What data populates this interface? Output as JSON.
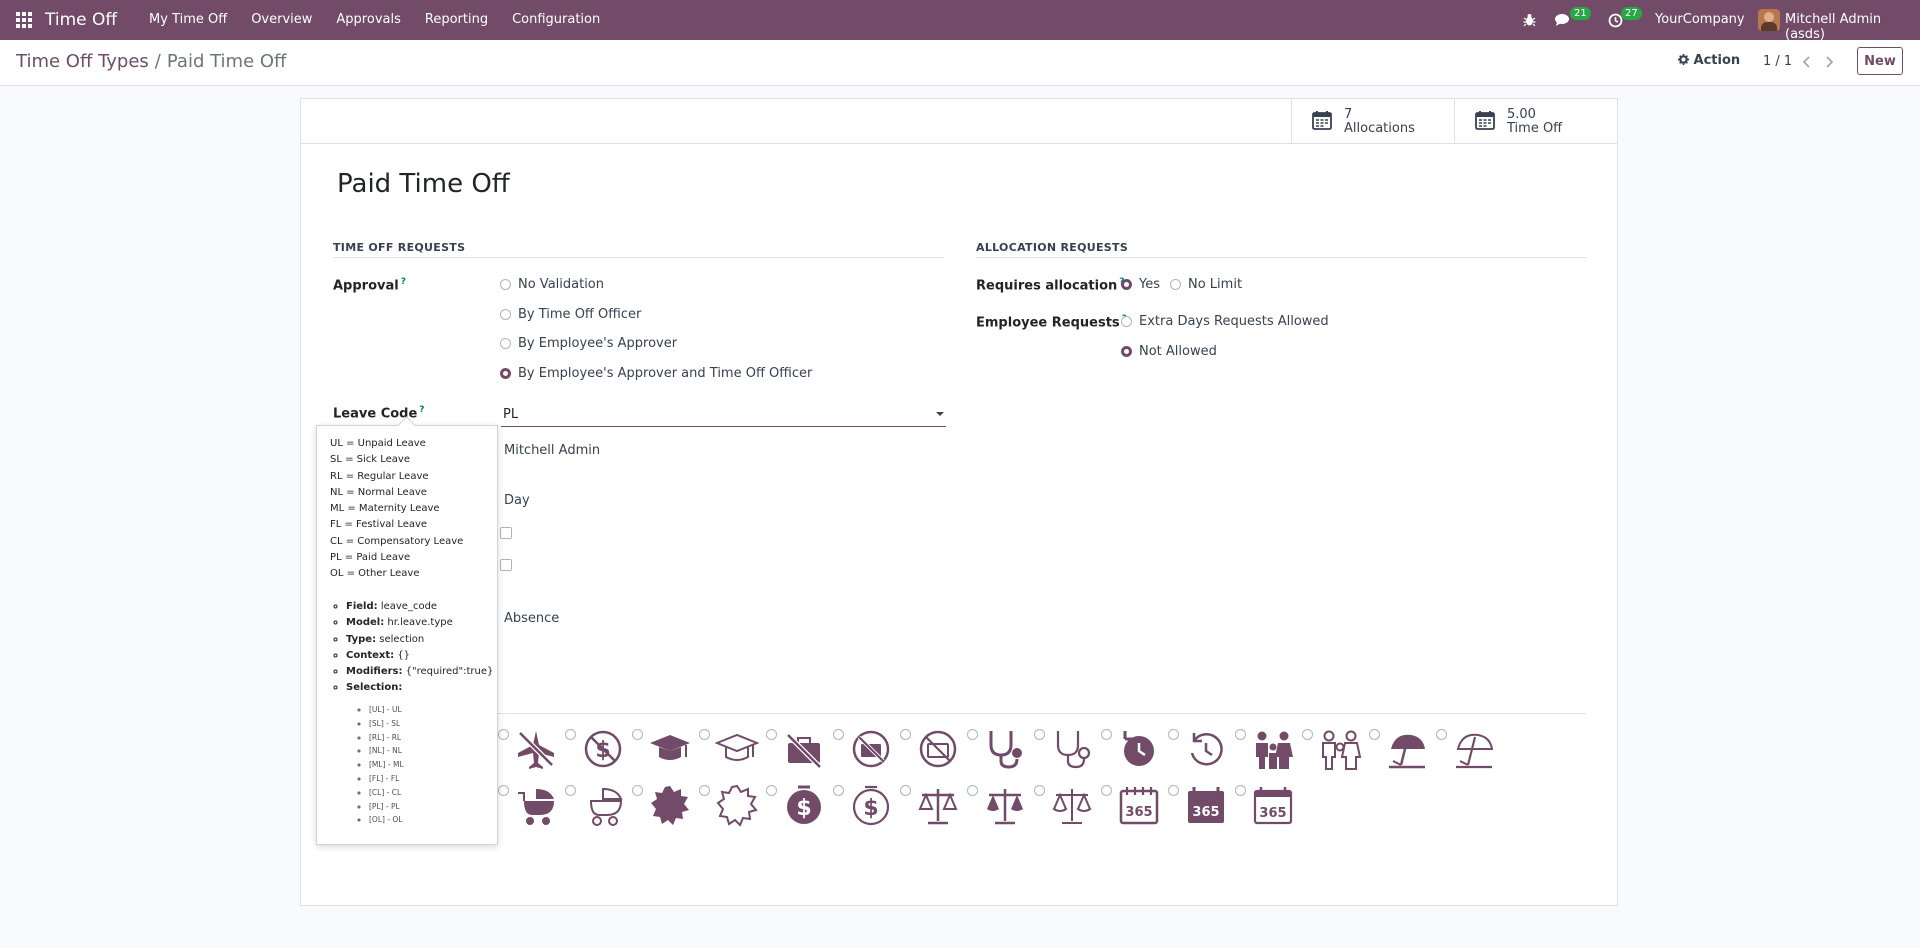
{
  "navbar": {
    "brand": "Time Off",
    "menu": [
      "My Time Off",
      "Overview",
      "Approvals",
      "Reporting",
      "Configuration"
    ],
    "messages_count": "21",
    "activities_count": "27",
    "company": "YourCompany",
    "user": "Mitchell Admin (asds)",
    "accent_color": "#714b67"
  },
  "control": {
    "breadcrumb_parent": "Time Off Types",
    "breadcrumb_sep": "/",
    "breadcrumb_current": "Paid Time Off",
    "action_label": "Action",
    "pager": "1 / 1",
    "new_label": "New"
  },
  "stats": {
    "allocations_value": "7",
    "allocations_label": "Allocations",
    "timeoff_value": "5.00",
    "timeoff_label": "Time Off"
  },
  "form": {
    "title": "Paid Time Off",
    "left_section": "TIME OFF REQUESTS",
    "right_section": "ALLOCATION REQUESTS",
    "approval_label": "Approval",
    "approval_options": [
      "No Validation",
      "By Time Off Officer",
      "By Employee's Approver",
      "By Employee's Approver and Time Off Officer"
    ],
    "approval_selected": 3,
    "requires_allocation_label": "Requires allocation",
    "requires_allocation_options": [
      "Yes",
      "No Limit"
    ],
    "employee_requests_label": "Employee Requests",
    "employee_requests_options": [
      "Extra Days Requests Allowed",
      "Not Allowed"
    ],
    "leave_code_label": "Leave Code",
    "leave_code_value": "PL",
    "responsible_value": "Mitchell Admin",
    "unit_value": "Day",
    "kind_value": "Absence",
    "help_mark": "?"
  },
  "tooltip": {
    "lines": [
      "UL = Unpaid Leave",
      "SL = Sick Leave",
      "RL = Regular Leave",
      "NL = Normal Leave",
      "ML = Maternity Leave",
      "FL = Festival Leave",
      "CL = Compensatory Leave",
      "PL = Paid Leave",
      "OL = Other Leave"
    ],
    "field_key": "Field:",
    "field_val": "leave_code",
    "model_key": "Model:",
    "model_val": "hr.leave.type",
    "type_key": "Type:",
    "type_val": "selection",
    "context_key": "Context:",
    "context_val": "{}",
    "modifiers_key": "Modifiers:",
    "modifiers_val": "{\"required\":true}",
    "selection_key": "Selection:",
    "selection": [
      "[UL] - UL",
      "[SL] - SL",
      "[RL] - RL",
      "[NL] - NL",
      "[ML] - ML",
      "[FL] - FL",
      "[CL] - CL",
      "[PL] - PL",
      "[OL] - OL"
    ]
  }
}
